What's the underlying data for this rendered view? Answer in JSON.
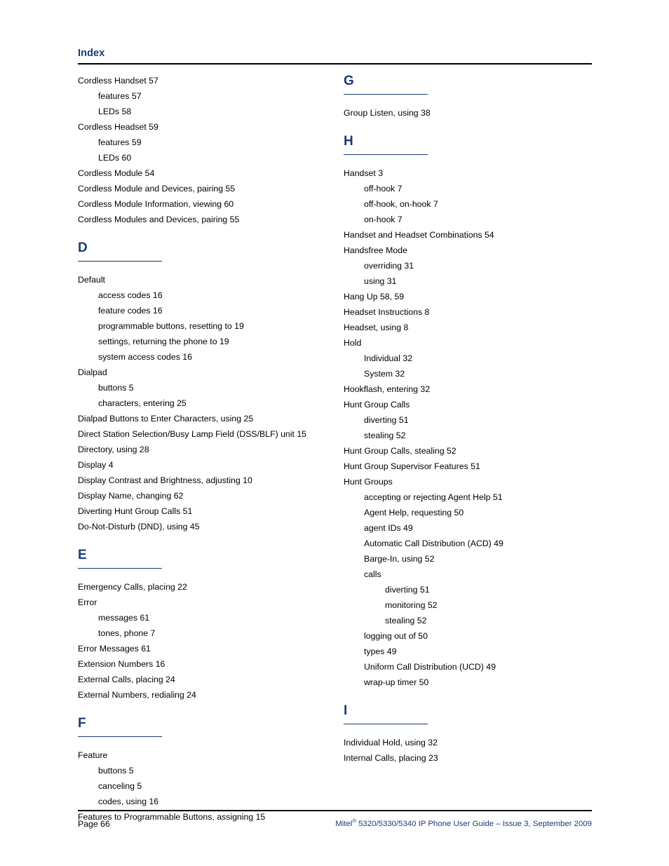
{
  "header": {
    "title": "Index"
  },
  "columns": {
    "left": [
      {
        "type": "entry",
        "level": 1,
        "text": "Cordless Handset  57"
      },
      {
        "type": "entry",
        "level": 2,
        "text": "features  57"
      },
      {
        "type": "entry",
        "level": 2,
        "text": "LEDs  58"
      },
      {
        "type": "entry",
        "level": 1,
        "text": "Cordless Headset  59"
      },
      {
        "type": "entry",
        "level": 2,
        "text": "features  59"
      },
      {
        "type": "entry",
        "level": 2,
        "text": "LEDs  60"
      },
      {
        "type": "entry",
        "level": 1,
        "text": "Cordless Module  54"
      },
      {
        "type": "entry",
        "level": 1,
        "text": "Cordless Module and Devices, pairing  55"
      },
      {
        "type": "entry",
        "level": 1,
        "text": "Cordless Module Information, viewing  60"
      },
      {
        "type": "entry",
        "level": 1,
        "text": "Cordless Modules and Devices, pairing  55"
      },
      {
        "type": "letter",
        "letter": "D"
      },
      {
        "type": "entry",
        "level": 1,
        "text": "Default"
      },
      {
        "type": "entry",
        "level": 2,
        "text": "access codes  16"
      },
      {
        "type": "entry",
        "level": 2,
        "text": "feature codes  16"
      },
      {
        "type": "entry",
        "level": 2,
        "text": "programmable buttons, resetting to  19"
      },
      {
        "type": "entry",
        "level": 2,
        "text": "settings, returning the phone to  19"
      },
      {
        "type": "entry",
        "level": 2,
        "text": "system access codes  16"
      },
      {
        "type": "entry",
        "level": 1,
        "text": "Dialpad"
      },
      {
        "type": "entry",
        "level": 2,
        "text": "buttons  5"
      },
      {
        "type": "entry",
        "level": 2,
        "text": "characters, entering  25"
      },
      {
        "type": "entry",
        "level": 1,
        "text": "Dialpad Buttons to Enter Characters, using  25"
      },
      {
        "type": "entry",
        "level": 1,
        "text": "Direct Station Selection/Busy Lamp Field (DSS/BLF) unit  15"
      },
      {
        "type": "entry",
        "level": 1,
        "text": "Directory, using  28"
      },
      {
        "type": "entry",
        "level": 1,
        "text": "Display  4"
      },
      {
        "type": "entry",
        "level": 1,
        "text": "Display Contrast and Brightness, adjusting  10"
      },
      {
        "type": "entry",
        "level": 1,
        "text": "Display Name, changing  62"
      },
      {
        "type": "entry",
        "level": 1,
        "text": "Diverting Hunt Group Calls  51"
      },
      {
        "type": "entry",
        "level": 1,
        "text": "Do-Not-Disturb (DND), using  45"
      },
      {
        "type": "letter",
        "letter": "E"
      },
      {
        "type": "entry",
        "level": 1,
        "text": "Emergency Calls, placing  22"
      },
      {
        "type": "entry",
        "level": 1,
        "text": "Error"
      },
      {
        "type": "entry",
        "level": 2,
        "text": "messages  61"
      },
      {
        "type": "entry",
        "level": 2,
        "text": "tones, phone  7"
      },
      {
        "type": "entry",
        "level": 1,
        "text": "Error Messages  61"
      },
      {
        "type": "entry",
        "level": 1,
        "text": "Extension Numbers  16"
      },
      {
        "type": "entry",
        "level": 1,
        "text": "External Calls, placing  24"
      },
      {
        "type": "entry",
        "level": 1,
        "text": "External Numbers, redialing  24"
      },
      {
        "type": "letter",
        "letter": "F"
      },
      {
        "type": "entry",
        "level": 1,
        "text": "Feature"
      },
      {
        "type": "entry",
        "level": 2,
        "text": "buttons  5"
      },
      {
        "type": "entry",
        "level": 2,
        "text": "canceling  5"
      },
      {
        "type": "entry",
        "level": 2,
        "text": "codes, using  16"
      },
      {
        "type": "entry",
        "level": 1,
        "text": "Features to Programmable Buttons, assigning  15"
      }
    ],
    "right": [
      {
        "type": "letter",
        "letter": "G",
        "first": true
      },
      {
        "type": "entry",
        "level": 1,
        "text": "Group Listen, using  38"
      },
      {
        "type": "letter",
        "letter": "H"
      },
      {
        "type": "entry",
        "level": 1,
        "text": "Handset  3"
      },
      {
        "type": "entry",
        "level": 2,
        "text": "off-hook  7"
      },
      {
        "type": "entry",
        "level": 2,
        "text": "off-hook, on-hook  7"
      },
      {
        "type": "entry",
        "level": 2,
        "text": "on-hook  7"
      },
      {
        "type": "entry",
        "level": 1,
        "text": "Handset and Headset Combinations  54"
      },
      {
        "type": "entry",
        "level": 1,
        "text": "Handsfree Mode"
      },
      {
        "type": "entry",
        "level": 2,
        "text": "overriding  31"
      },
      {
        "type": "entry",
        "level": 2,
        "text": "using  31"
      },
      {
        "type": "entry",
        "level": 1,
        "text": "Hang Up  58,  59"
      },
      {
        "type": "entry",
        "level": 1,
        "text": "Headset Instructions  8"
      },
      {
        "type": "entry",
        "level": 1,
        "text": "Headset, using  8"
      },
      {
        "type": "entry",
        "level": 1,
        "text": "Hold"
      },
      {
        "type": "entry",
        "level": 2,
        "text": "Individual  32"
      },
      {
        "type": "entry",
        "level": 2,
        "text": "System  32"
      },
      {
        "type": "entry",
        "level": 1,
        "text": "Hookflash, entering  32"
      },
      {
        "type": "entry",
        "level": 1,
        "text": "Hunt Group Calls"
      },
      {
        "type": "entry",
        "level": 2,
        "text": "diverting  51"
      },
      {
        "type": "entry",
        "level": 2,
        "text": "stealing  52"
      },
      {
        "type": "entry",
        "level": 1,
        "text": "Hunt Group Calls, stealing  52"
      },
      {
        "type": "entry",
        "level": 1,
        "text": "Hunt Group Supervisor Features  51"
      },
      {
        "type": "entry",
        "level": 1,
        "text": "Hunt Groups"
      },
      {
        "type": "entry",
        "level": 2,
        "text": "accepting or rejecting Agent Help  51"
      },
      {
        "type": "entry",
        "level": 2,
        "text": "Agent Help, requesting  50"
      },
      {
        "type": "entry",
        "level": 2,
        "text": "agent IDs  49"
      },
      {
        "type": "entry",
        "level": 2,
        "text": "Automatic Call Distribution (ACD)  49"
      },
      {
        "type": "entry",
        "level": 2,
        "text": "Barge-In, using  52"
      },
      {
        "type": "entry",
        "level": 2,
        "text": "calls"
      },
      {
        "type": "entry",
        "level": 3,
        "text": "diverting  51"
      },
      {
        "type": "entry",
        "level": 3,
        "text": "monitoring  52"
      },
      {
        "type": "entry",
        "level": 3,
        "text": "stealing  52"
      },
      {
        "type": "entry",
        "level": 2,
        "text": "logging out of  50"
      },
      {
        "type": "entry",
        "level": 2,
        "text": "types  49"
      },
      {
        "type": "entry",
        "level": 2,
        "text": "Uniform Call Distribution (UCD)  49"
      },
      {
        "type": "entry",
        "level": 2,
        "text": "wrap-up timer  50"
      },
      {
        "type": "letter",
        "letter": "I"
      },
      {
        "type": "entry",
        "level": 1,
        "text": "Individual Hold, using  32"
      },
      {
        "type": "entry",
        "level": 1,
        "text": "Internal Calls, placing  23"
      }
    ]
  },
  "footer": {
    "page_label": "Page 66",
    "guide_brand": "Mitel",
    "guide_registered_mark": "®",
    "guide_text": " 5320/5330/5340 IP Phone User Guide  – Issue 3, September 2009"
  },
  "colors": {
    "heading_navy": "#1b3a77",
    "rule_black": "#000000",
    "body_text": "#000000"
  }
}
